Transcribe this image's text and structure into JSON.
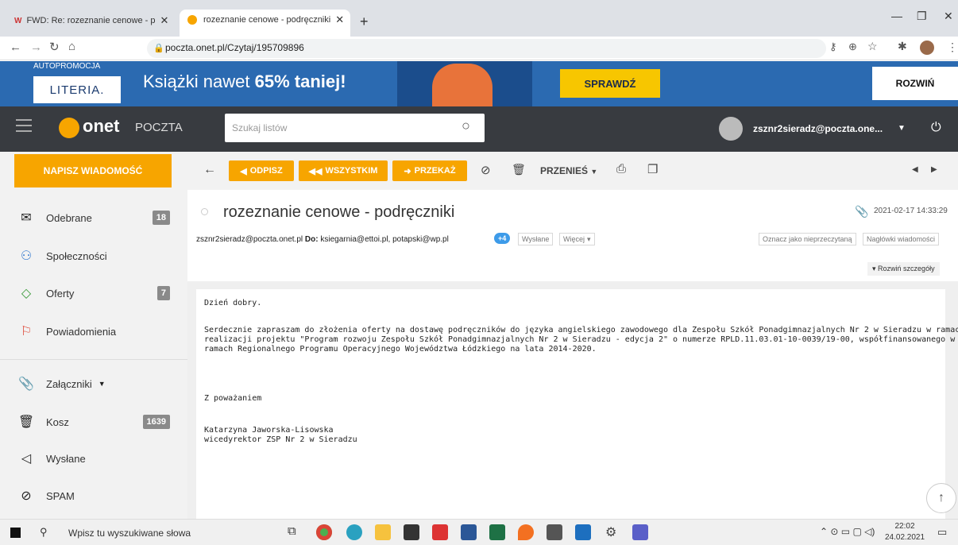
{
  "browser": {
    "tabs": [
      {
        "label": "FWD: Re: rozeznanie cenowe - p"
      },
      {
        "label": "rozeznanie cenowe - podręczniki"
      }
    ],
    "new_tab": "+",
    "url": "poczta.onet.pl/Czytaj/195709896",
    "window_controls": {
      "min": "—",
      "max": "❐",
      "close": "✕"
    }
  },
  "banner": {
    "small": "AUTOPROMOCJA",
    "logo": "LITERIA.",
    "headline_prefix": "Książki nawet ",
    "headline_bold": "65% taniej!",
    "cta": "SPRAWDŹ",
    "expand": "ROZWIŃ"
  },
  "header": {
    "logo_word": "onet",
    "logo_sub": "POCZTA",
    "search_placeholder": "Szukaj listów",
    "account": "zsznr2sieradz@poczta.one..."
  },
  "sidebar": {
    "compose": "NAPISZ WIADOMOŚĆ",
    "items": [
      {
        "label": "Odebrane",
        "badge": "18"
      },
      {
        "label": "Społeczności",
        "badge": ""
      },
      {
        "label": "Oferty",
        "badge": "7"
      },
      {
        "label": "Powiadomienia",
        "badge": ""
      },
      {
        "label": "Załączniki",
        "badge": ""
      },
      {
        "label": "Kosz",
        "badge": "1639"
      },
      {
        "label": "Wysłane",
        "badge": ""
      },
      {
        "label": "SPAM",
        "badge": ""
      }
    ]
  },
  "toolbar": {
    "reply": "ODPISZ",
    "reply_all": "WSZYSTKIM",
    "forward": "PRZEKAŻ",
    "move": "PRZENIEŚ"
  },
  "message": {
    "subject": "rozeznanie cenowe - podręczniki",
    "date": "2021-02-17 14:33:29",
    "from": "zsznr2sieradz@poczta.onet.pl",
    "to_label": "Do:",
    "to": "ksiegarnia@ettoi.pl, potapski@wp.pl",
    "more_recipients": "+4",
    "tag_sent": "Wysłane",
    "tag_more": "Więcej",
    "mark_unread": "Oznacz jako nieprzeczytaną",
    "headers": "Nagłówki wiadomości",
    "expand_details": "Rozwiń szczegóły",
    "body": {
      "greeting": "Dzień dobry.",
      "p1_l1": "Serdecznie zapraszam do złożenia oferty na dostawę podręczników do języka angielskiego zawodowego dla Zespołu Szkół Ponadgimnazjalnych Nr 2 w Sieradzu w ramach",
      "p1_l2": "realizacji projektu \"Program rozwoju Zespołu Szkół Ponadgimnazjalnych Nr 2 w Sieradzu - edycja 2\" o numerze RPLD.11.03.01-10-0039/19-00, współfinansowanego w",
      "p1_l3": "ramach Regionalnego Programu Operacyjnego Województwa Łódzkiego na lata 2014-2020.",
      "closing": "Z poważaniem",
      "sig_name": "Katarzyna Jaworska-Lisowska",
      "sig_title": "wicedyrektor ZSP Nr 2 w Sieradzu"
    }
  },
  "taskbar": {
    "search": "Wpisz tu wyszukiwane słowa",
    "time": "22:02",
    "date": "24.02.2021"
  },
  "colors": {
    "accent": "#f7a500",
    "header": "#383b40",
    "banner": "#2b6ab1",
    "badge_blue": "#3d9be9"
  }
}
